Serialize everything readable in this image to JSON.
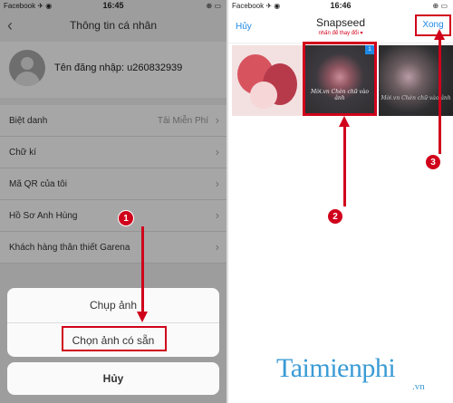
{
  "left_screen": {
    "status": {
      "carrier": "Facebook ✈ ◉",
      "time": "16:45",
      "battery": "⊕ ▭"
    },
    "nav": {
      "back": "‹",
      "title": "Thông tin cá nhân"
    },
    "profile": {
      "username_label": "Tên đăng nhập: u260832939"
    },
    "rows": [
      {
        "label": "Biệt danh",
        "value": "Tải Miễn Phí"
      },
      {
        "label": "Chữ kí",
        "value": ""
      },
      {
        "label": "Mã QR của tôi",
        "value": ""
      },
      {
        "label": "Hồ Sơ Anh Hùng",
        "value": ""
      },
      {
        "label": "Khách hàng thân thiết Garena",
        "value": ""
      }
    ],
    "chevron": "›",
    "sheet": {
      "take_photo": "Chụp ảnh",
      "choose_photo": "Chọn ảnh có sẵn",
      "cancel": "Hủy"
    },
    "step_badge": "1"
  },
  "right_screen": {
    "status": {
      "carrier": "Facebook ✈ ◉",
      "time": "16:46",
      "battery": "⊕ ▭"
    },
    "nav": {
      "cancel": "Hủy",
      "title": "Snapseed",
      "subtitle": "nhấn để thay đổi ▾",
      "done": "Xong"
    },
    "thumb_captions": [
      "Mời.vn Chèn chữ vào ảnh",
      "Mời.vn Chèn chữ vào ảnh"
    ],
    "check": "1",
    "step_badges": [
      "2",
      "3"
    ]
  },
  "watermark": {
    "main": "Taimienphi",
    "sub": ".vn"
  },
  "colors": {
    "accent_red": "#d0021b",
    "ios_blue": "#1e88e5",
    "watermark": "#3a9bd5"
  }
}
